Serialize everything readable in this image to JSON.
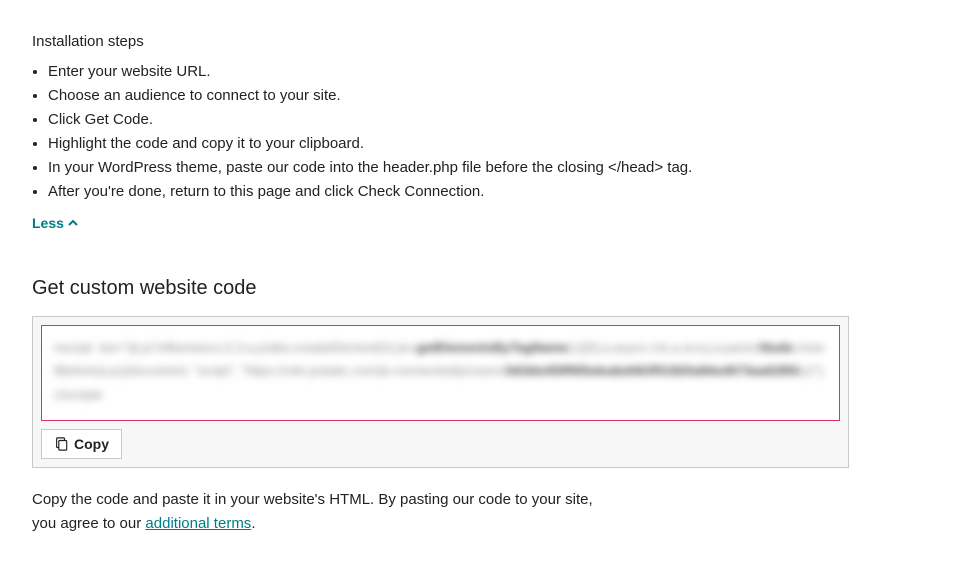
{
  "installation": {
    "title": "Installation steps",
    "steps": [
      "Enter your website URL.",
      "Choose an audience to connect to your site.",
      "Click Get Code.",
      "Highlight the code and copy it to your clipboard.",
      "In your WordPress theme, paste our code into the header.php file before the closing </head> tag.",
      "After you're done, return to this page and click Check Connection."
    ],
    "less_label": "Less"
  },
  "code_section": {
    "heading": "Get custom website code",
    "copy_label": "Copy"
  },
  "instructions": {
    "line1": "Copy the code and paste it in your website's HTML. By pasting our code to your site,",
    "line2_prefix": "you agree to our ",
    "terms_link": "additional terms",
    "line2_suffix": "."
  }
}
